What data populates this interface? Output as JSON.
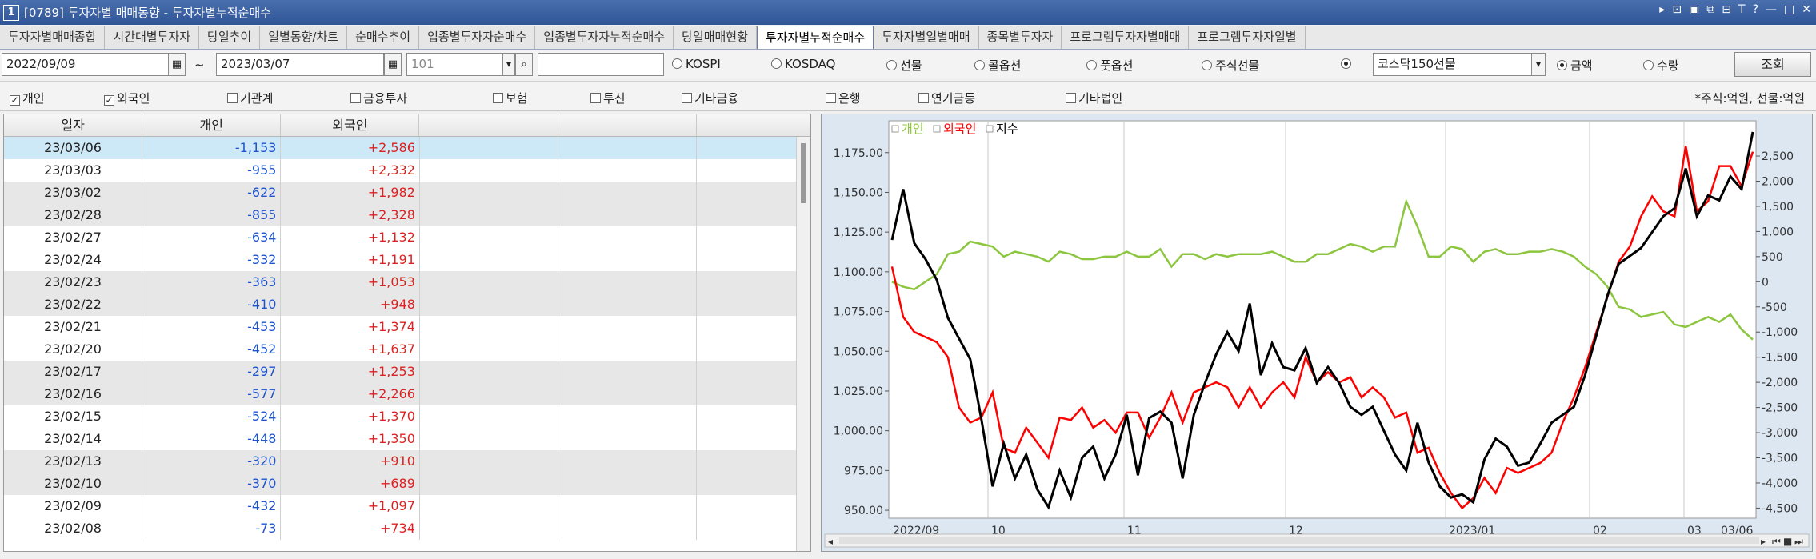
{
  "window": {
    "icon_label": "1",
    "title": "[0789] 투자자별 매매동향 - 투자자별누적순매수",
    "controls": [
      "▸",
      "⊡",
      "▣",
      "⧉",
      "⊟",
      "T",
      "?",
      "—",
      "□",
      "✕"
    ]
  },
  "tabs": [
    {
      "label": "투자자별매매종합",
      "active": false
    },
    {
      "label": "시간대별투자자",
      "active": false
    },
    {
      "label": "당일추이",
      "active": false
    },
    {
      "label": "일별동향/차트",
      "active": false
    },
    {
      "label": "순매수추이",
      "active": false
    },
    {
      "label": "업종별투자자순매수",
      "active": false
    },
    {
      "label": "업종별투자자누적순매수",
      "active": false
    },
    {
      "label": "당일매매현황",
      "active": false
    },
    {
      "label": "투자자별누적순매수",
      "active": true
    },
    {
      "label": "투자자별일별매매",
      "active": false
    },
    {
      "label": "종목별투자자",
      "active": false
    },
    {
      "label": "프로그램투자자별매매",
      "active": false
    },
    {
      "label": "프로그램투자자일별",
      "active": false
    }
  ],
  "query": {
    "start_date": "2022/09/09",
    "tilde": "~",
    "end_date": "2023/03/07",
    "code": "101",
    "name": "",
    "markets": [
      {
        "label": "KOSPI",
        "selected": false
      },
      {
        "label": "KOSDAQ",
        "selected": false
      },
      {
        "label": "선물",
        "selected": false
      },
      {
        "label": "콜옵션",
        "selected": false
      },
      {
        "label": "풋옵션",
        "selected": false
      },
      {
        "label": "주식선물",
        "selected": false
      },
      {
        "label": "",
        "selected": true
      }
    ],
    "futures_select": "코스닥150선물",
    "units": [
      {
        "label": "금액",
        "selected": true
      },
      {
        "label": "수량",
        "selected": false
      }
    ],
    "search_button": "조회"
  },
  "investors": [
    {
      "label": "개인",
      "checked": true
    },
    {
      "label": "외국인",
      "checked": true
    },
    {
      "label": "기관계",
      "checked": false
    },
    {
      "label": "금융투자",
      "checked": false
    },
    {
      "label": "보험",
      "checked": false
    },
    {
      "label": "투신",
      "checked": false
    },
    {
      "label": "기타금융",
      "checked": false
    },
    {
      "label": "은행",
      "checked": false
    },
    {
      "label": "연기금등",
      "checked": false
    },
    {
      "label": "기타법인",
      "checked": false
    }
  ],
  "unit_note": "*주식:억원, 선물:억원",
  "grid": {
    "headers": [
      "일자",
      "개인",
      "외국인",
      "",
      "",
      ""
    ],
    "rows": [
      {
        "date": "23/03/06",
        "individual": "-1,153",
        "foreign": "+2,586"
      },
      {
        "date": "23/03/03",
        "individual": "-955",
        "foreign": "+2,332"
      },
      {
        "date": "23/03/02",
        "individual": "-622",
        "foreign": "+1,982"
      },
      {
        "date": "23/02/28",
        "individual": "-855",
        "foreign": "+2,328"
      },
      {
        "date": "23/02/27",
        "individual": "-634",
        "foreign": "+1,132"
      },
      {
        "date": "23/02/24",
        "individual": "-332",
        "foreign": "+1,191"
      },
      {
        "date": "23/02/23",
        "individual": "-363",
        "foreign": "+1,053"
      },
      {
        "date": "23/02/22",
        "individual": "-410",
        "foreign": "+948"
      },
      {
        "date": "23/02/21",
        "individual": "-453",
        "foreign": "+1,374"
      },
      {
        "date": "23/02/20",
        "individual": "-452",
        "foreign": "+1,637"
      },
      {
        "date": "23/02/17",
        "individual": "-297",
        "foreign": "+1,253"
      },
      {
        "date": "23/02/16",
        "individual": "-577",
        "foreign": "+2,266"
      },
      {
        "date": "23/02/15",
        "individual": "-524",
        "foreign": "+1,370"
      },
      {
        "date": "23/02/14",
        "individual": "-448",
        "foreign": "+1,350"
      },
      {
        "date": "23/02/13",
        "individual": "-320",
        "foreign": "+910"
      },
      {
        "date": "23/02/10",
        "individual": "-370",
        "foreign": "+689"
      },
      {
        "date": "23/02/09",
        "individual": "-432",
        "foreign": "+1,097"
      },
      {
        "date": "23/02/08",
        "individual": "-73",
        "foreign": "+734"
      }
    ]
  },
  "chart_data": {
    "type": "line",
    "legend": [
      {
        "name": "개인",
        "color": "#8cc63f"
      },
      {
        "name": "외국인",
        "color": "#ff0000"
      },
      {
        "name": "지수",
        "color": "#000000"
      }
    ],
    "left_axis": {
      "ticks": [
        "1,175.00",
        "1,150.00",
        "1,125.00",
        "1,100.00",
        "1,075.00",
        "1,050.00",
        "1,025.00",
        "1,000.00",
        "975.00",
        "950.00"
      ],
      "ylim": [
        945,
        1195
      ]
    },
    "right_axis": {
      "ticks": [
        "2,500",
        "2,000",
        "1,500",
        "1,000",
        "500",
        "0",
        "-500",
        "-1,000",
        "-1,500",
        "-2,000",
        "-2,500",
        "-3,000",
        "-3,500",
        "-4,000",
        "-4,500"
      ],
      "ylim": [
        -4700,
        3200
      ]
    },
    "x_ticks": [
      "2022/09",
      "10",
      "11",
      "12",
      "2023/01",
      "02",
      "03",
      "03/06"
    ],
    "series": [
      {
        "name": "개인",
        "axis": "right",
        "values": [
          0,
          -100,
          -150,
          0,
          150,
          550,
          600,
          800,
          750,
          700,
          500,
          600,
          550,
          500,
          400,
          600,
          550,
          450,
          450,
          500,
          500,
          600,
          500,
          500,
          650,
          300,
          550,
          550,
          450,
          550,
          500,
          550,
          550,
          550,
          600,
          500,
          400,
          400,
          550,
          550,
          650,
          750,
          700,
          600,
          700,
          700,
          1600,
          1100,
          500,
          500,
          700,
          650,
          400,
          600,
          650,
          550,
          550,
          600,
          600,
          650,
          600,
          500,
          300,
          150,
          -100,
          -500,
          -550,
          -700,
          -650,
          -600,
          -850,
          -900,
          -800,
          -700,
          -800,
          -650,
          -950,
          -1150
        ]
      },
      {
        "name": "외국인",
        "axis": "right",
        "values": [
          300,
          -700,
          -1000,
          -1100,
          -1200,
          -1500,
          -2500,
          -2800,
          -2700,
          -2200,
          -3300,
          -3400,
          -2900,
          -3200,
          -3500,
          -2700,
          -2750,
          -2500,
          -2900,
          -2750,
          -3000,
          -2600,
          -2600,
          -3100,
          -2700,
          -2200,
          -2800,
          -2200,
          -2100,
          -2000,
          -2100,
          -2500,
          -2100,
          -2500,
          -2200,
          -2000,
          -2300,
          -1500,
          -2000,
          -1800,
          -2000,
          -1900,
          -2300,
          -2100,
          -2300,
          -2700,
          -2600,
          -3400,
          -3300,
          -3800,
          -4200,
          -4500,
          -4300,
          -3900,
          -4200,
          -3700,
          -3800,
          -3700,
          -3600,
          -3400,
          -2800,
          -2300,
          -1700,
          -1000,
          -300,
          400,
          700,
          1300,
          1700,
          1400,
          1300,
          2700,
          1400,
          1600,
          2300,
          2300,
          1900,
          2586
        ]
      },
      {
        "name": "지수",
        "axis": "left",
        "values": [
          1120,
          1152,
          1118,
          1108,
          1095,
          1071,
          1058,
          1045,
          1007,
          965,
          992,
          970,
          985,
          963,
          952,
          975,
          958,
          983,
          990,
          970,
          985,
          1010,
          972,
          1008,
          1012,
          1005,
          970,
          1010,
          1030,
          1048,
          1062,
          1050,
          1080,
          1035,
          1055,
          1040,
          1038,
          1052,
          1030,
          1040,
          1030,
          1015,
          1010,
          1015,
          1000,
          985,
          975,
          1005,
          980,
          965,
          958,
          960,
          955,
          982,
          995,
          990,
          978,
          980,
          992,
          1005,
          1010,
          1015,
          1035,
          1060,
          1085,
          1105,
          1110,
          1115,
          1125,
          1135,
          1140,
          1165,
          1135,
          1148,
          1145,
          1160,
          1152,
          1188
        ]
      }
    ]
  }
}
